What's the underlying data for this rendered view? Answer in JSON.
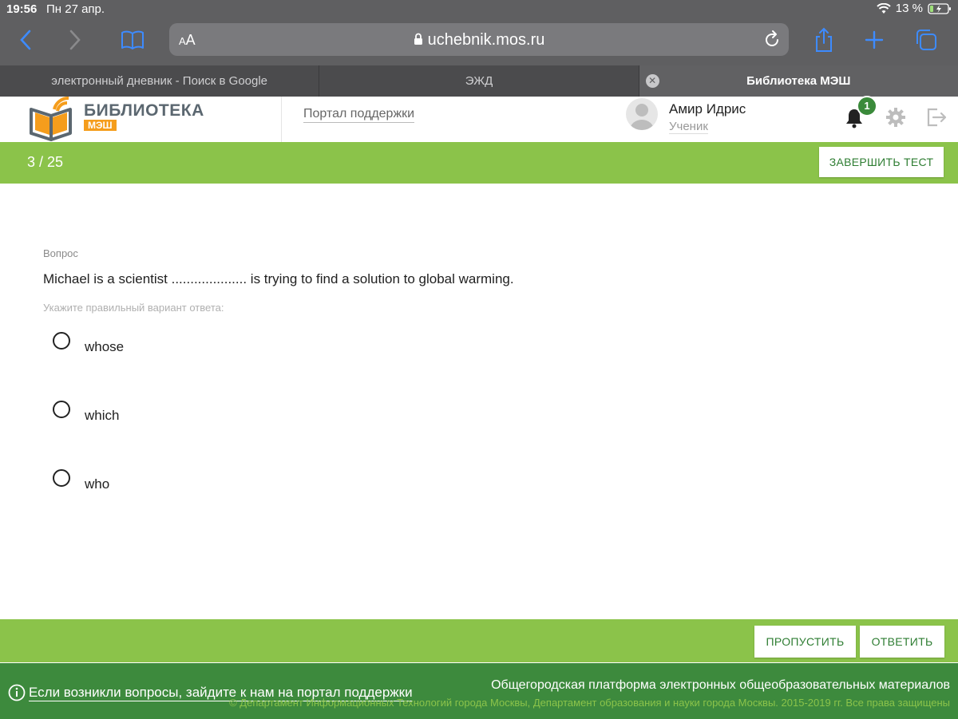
{
  "status": {
    "time": "19:56",
    "date": "Пн 27 апр.",
    "battery": "13 %"
  },
  "browser": {
    "aa_small": "A",
    "aa_large": "A",
    "url": "uchebnik.mos.ru",
    "tabs": [
      {
        "label": "электронный дневник - Поиск в Google",
        "active": false
      },
      {
        "label": "ЭЖД",
        "active": false
      },
      {
        "label": "Библиотека МЭШ",
        "active": true
      }
    ]
  },
  "header": {
    "brand_name": "БИБЛИОТЕКА",
    "brand_sub": "МЭШ",
    "support_link": "Портал поддержки",
    "user_name": "Амир Идрис",
    "user_role": "Ученик",
    "notifications": "1"
  },
  "test": {
    "counter": "3 / 25",
    "finish_label": "ЗАВЕРШИТЬ ТЕСТ",
    "question_label": "Вопрос",
    "question_text": "Michael is a scientist .................... is trying to find a solution to global warming.",
    "hint": "Укажите правильный вариант ответа:",
    "options": [
      "whose",
      "which",
      "who"
    ],
    "skip_label": "ПРОПУСТИТЬ",
    "answer_label": "ОТВЕТИТЬ"
  },
  "footer": {
    "help_text": "Если возникли вопросы, зайдите к нам на портал поддержки",
    "platform": "Общегородская платформа электронных общеобразовательных материалов",
    "copyright": "© Департамент Информационных Технологий города Москвы, Департамент образования и науки города Москвы. 2015-2019 гг. Все права защищены"
  },
  "colors": {
    "green_light": "#8bc34a",
    "green_dark": "#3d8a3d",
    "brand_orange": "#f59d1c"
  }
}
